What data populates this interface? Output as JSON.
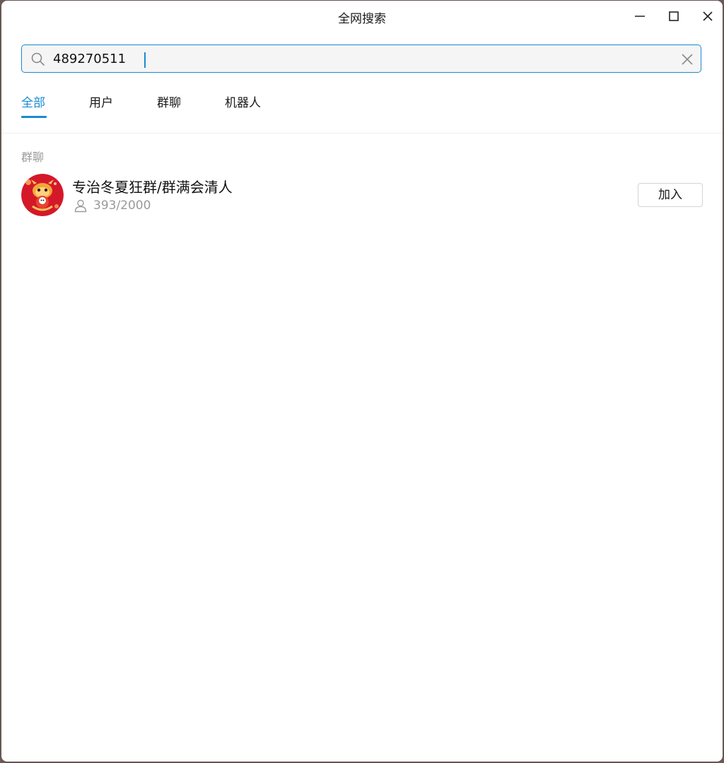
{
  "window": {
    "title": "全网搜索"
  },
  "search": {
    "value": "489270511",
    "placeholder": ""
  },
  "tabs": [
    {
      "label": "全部",
      "active": true
    },
    {
      "label": "用户",
      "active": false
    },
    {
      "label": "群聊",
      "active": false
    },
    {
      "label": "机器人",
      "active": false
    }
  ],
  "results": {
    "section_label": "群聊",
    "items": [
      {
        "name": "专治冬夏狂群/群满会清人",
        "member_count": "393/2000",
        "join_label": "加入",
        "avatar_icon": "dragon-avatar"
      }
    ]
  },
  "colors": {
    "accent": "#1b8ad3",
    "secondary_text": "#999999"
  }
}
